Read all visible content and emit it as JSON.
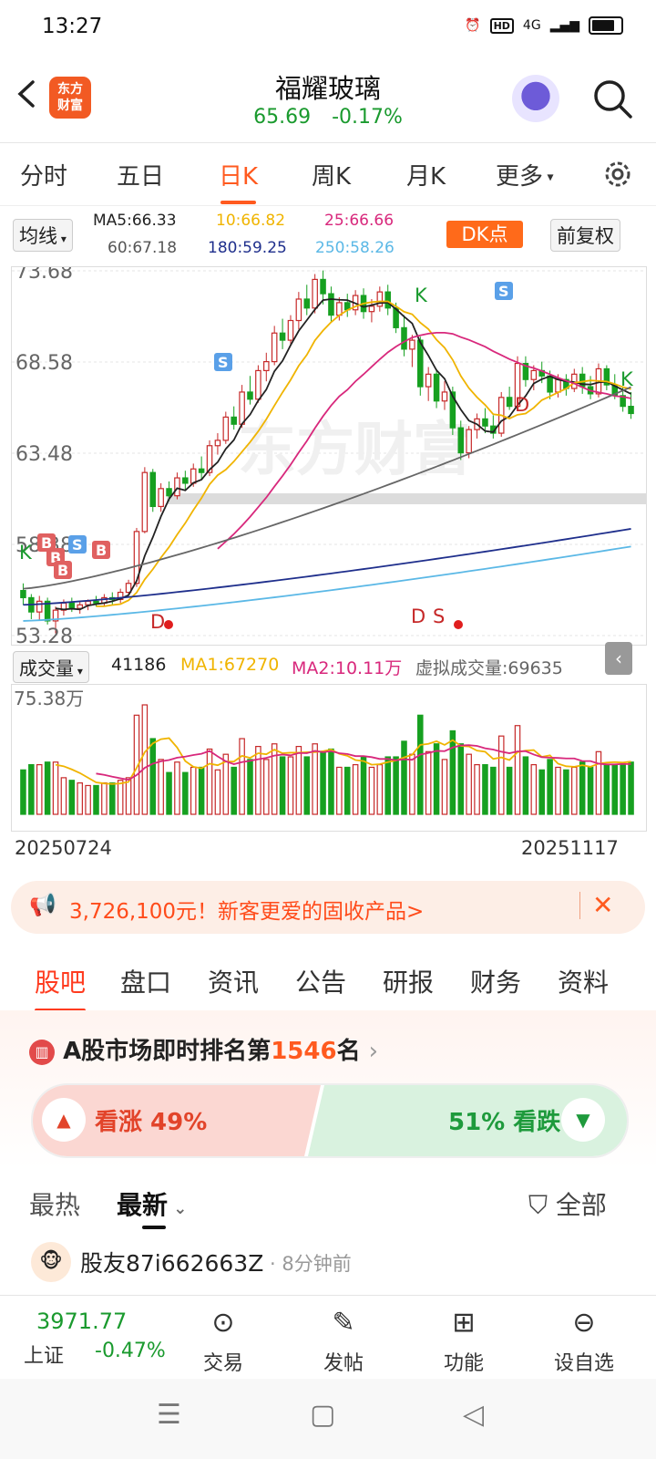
{
  "status": {
    "time": "13:27",
    "hd": "HD",
    "net": "4G"
  },
  "header": {
    "logo_text": "东方\n财富",
    "title": "福耀玻璃",
    "price": "65.69",
    "change": "-0.17%"
  },
  "period_tabs": [
    "分时",
    "五日",
    "日K",
    "周K",
    "月K",
    "更多"
  ],
  "active_period": "日K",
  "ma": {
    "selector": "均线",
    "ma5": "MA5:66.33",
    "ma10": "10:66.82",
    "ma25": "25:66.66",
    "ma60": "60:67.18",
    "ma180": "180:59.25",
    "ma250": "250:58.26",
    "dk_label": "DK点",
    "adjust_label": "前复权"
  },
  "chart_data": {
    "type": "candlestick",
    "y_ticks": [
      "73.68",
      "68.58",
      "63.48",
      "58.38",
      "53.28"
    ],
    "ylim": [
      53.28,
      73.68
    ],
    "watermark": "东方财富",
    "marker_labels": [
      "K",
      "S",
      "K",
      "D",
      "S",
      "D",
      "K",
      "B",
      "B",
      "B",
      "S",
      "B",
      "D",
      "S"
    ],
    "candles": [
      [
        55.8,
        56.2,
        55.0,
        55.4
      ],
      [
        55.4,
        55.6,
        54.2,
        54.6
      ],
      [
        54.6,
        55.5,
        54.1,
        55.2
      ],
      [
        55.2,
        55.4,
        53.9,
        54.1
      ],
      [
        54.1,
        54.9,
        53.4,
        54.7
      ],
      [
        54.7,
        55.3,
        54.4,
        55.1
      ],
      [
        55.1,
        55.4,
        54.6,
        54.8
      ],
      [
        54.8,
        55.2,
        54.5,
        55.0
      ],
      [
        55.0,
        55.3,
        54.7,
        55.2
      ],
      [
        55.2,
        55.5,
        54.9,
        55.1
      ],
      [
        55.1,
        55.6,
        54.9,
        55.4
      ],
      [
        55.4,
        55.7,
        55.0,
        55.3
      ],
      [
        55.3,
        55.9,
        55.1,
        55.7
      ],
      [
        55.7,
        56.4,
        55.5,
        56.2
      ],
      [
        56.2,
        59.3,
        56.0,
        59.1
      ],
      [
        59.1,
        62.7,
        59.0,
        62.4
      ],
      [
        62.4,
        62.6,
        60.2,
        60.5
      ],
      [
        60.5,
        61.8,
        60.2,
        61.5
      ],
      [
        61.5,
        61.9,
        60.8,
        61.1
      ],
      [
        61.1,
        62.4,
        60.9,
        62.1
      ],
      [
        62.1,
        62.5,
        61.4,
        61.8
      ],
      [
        61.8,
        62.9,
        61.6,
        62.6
      ],
      [
        62.6,
        63.3,
        62.0,
        62.4
      ],
      [
        62.4,
        64.2,
        62.2,
        63.9
      ],
      [
        63.9,
        64.6,
        63.4,
        64.2
      ],
      [
        64.2,
        65.8,
        64.0,
        65.5
      ],
      [
        65.5,
        66.1,
        64.8,
        65.1
      ],
      [
        65.1,
        67.3,
        64.9,
        66.9
      ],
      [
        66.9,
        67.8,
        66.2,
        66.5
      ],
      [
        66.5,
        68.4,
        66.3,
        68.1
      ],
      [
        68.1,
        69.1,
        67.5,
        68.6
      ],
      [
        68.6,
        70.6,
        68.4,
        70.2
      ],
      [
        70.2,
        71.0,
        69.3,
        69.8
      ],
      [
        69.8,
        71.2,
        69.5,
        70.9
      ],
      [
        70.9,
        72.5,
        70.4,
        72.1
      ],
      [
        72.1,
        72.9,
        71.2,
        71.6
      ],
      [
        71.6,
        73.5,
        71.3,
        73.2
      ],
      [
        73.2,
        73.7,
        71.8,
        72.4
      ],
      [
        72.4,
        72.8,
        70.8,
        71.2
      ],
      [
        71.2,
        72.2,
        70.9,
        71.9
      ],
      [
        71.9,
        72.4,
        71.1,
        71.5
      ],
      [
        71.5,
        72.6,
        71.2,
        72.3
      ],
      [
        72.3,
        72.7,
        71.0,
        71.4
      ],
      [
        71.4,
        72.1,
        70.8,
        71.7
      ],
      [
        71.7,
        72.8,
        71.4,
        72.5
      ],
      [
        72.5,
        72.9,
        71.2,
        71.6
      ],
      [
        71.6,
        71.9,
        70.2,
        70.5
      ],
      [
        70.5,
        71.2,
        68.9,
        69.3
      ],
      [
        69.3,
        70.1,
        68.3,
        69.8
      ],
      [
        69.8,
        70.0,
        66.7,
        67.2
      ],
      [
        67.2,
        68.3,
        66.4,
        67.9
      ],
      [
        67.9,
        68.2,
        66.0,
        66.4
      ],
      [
        66.4,
        67.5,
        65.9,
        66.9
      ],
      [
        66.9,
        67.2,
        64.5,
        64.9
      ],
      [
        64.9,
        65.3,
        63.1,
        63.5
      ],
      [
        63.5,
        65.0,
        63.2,
        64.8
      ],
      [
        64.8,
        65.7,
        64.3,
        65.4
      ],
      [
        65.4,
        66.0,
        64.6,
        65.0
      ],
      [
        65.0,
        65.6,
        64.3,
        64.6
      ],
      [
        64.6,
        66.9,
        64.4,
        66.6
      ],
      [
        66.6,
        67.2,
        65.9,
        66.1
      ],
      [
        66.1,
        68.9,
        66.0,
        68.5
      ],
      [
        68.5,
        68.9,
        67.2,
        67.6
      ],
      [
        67.6,
        68.4,
        67.0,
        68.1
      ],
      [
        68.1,
        68.6,
        67.4,
        67.8
      ],
      [
        67.8,
        68.1,
        66.5,
        66.9
      ],
      [
        66.9,
        67.9,
        66.6,
        67.6
      ],
      [
        67.6,
        67.9,
        66.7,
        67.1
      ],
      [
        67.1,
        68.2,
        66.9,
        67.9
      ],
      [
        67.9,
        68.3,
        66.8,
        67.2
      ],
      [
        67.2,
        67.8,
        66.5,
        66.8
      ],
      [
        66.8,
        68.5,
        66.6,
        68.2
      ],
      [
        68.2,
        68.4,
        67.0,
        67.3
      ],
      [
        67.3,
        67.9,
        66.5,
        66.7
      ],
      [
        66.7,
        67.2,
        65.8,
        66.1
      ],
      [
        66.1,
        66.9,
        65.4,
        65.7
      ]
    ],
    "ma_lines": {
      "ma5_color": "#222222",
      "ma10_color": "#f0b400",
      "ma25_color": "#d8287c",
      "ma60_color": "#666666",
      "ma180_color": "#1f2f8c",
      "ma250_color": "#5bb8e6"
    },
    "volume_header": {
      "label": "成交量",
      "vol": "41186",
      "ma1": "MA1:67270",
      "ma2": "MA2:10.11万",
      "virtual": "虚拟成交量:69635"
    },
    "volume_max_label": "75.38万",
    "start_date": "20250724",
    "end_date": "20251117"
  },
  "promo": {
    "text": "3,726,100元！新客更爱的固收产品>"
  },
  "section_tabs": [
    "股吧",
    "盘口",
    "资讯",
    "公告",
    "研报",
    "财务",
    "资料"
  ],
  "active_section": "股吧",
  "rank": {
    "prefix": "A股市场即时排名第",
    "num": "1546",
    "suffix": "名"
  },
  "vote": {
    "up": "看涨 49%",
    "down": "51% 看跌"
  },
  "feed": {
    "hot": "最热",
    "latest": "最新",
    "filter": "全部"
  },
  "post": {
    "user": "股友87i662663Z",
    "time": "8分钟前"
  },
  "bottom": {
    "index_value": "3971.77",
    "index_name": "上证",
    "index_change": "-0.47%",
    "items": [
      "交易",
      "发帖",
      "功能",
      "设自选"
    ]
  },
  "colors": {
    "up": "#c62828",
    "down": "#16a020",
    "accent": "#ff5a1f"
  }
}
